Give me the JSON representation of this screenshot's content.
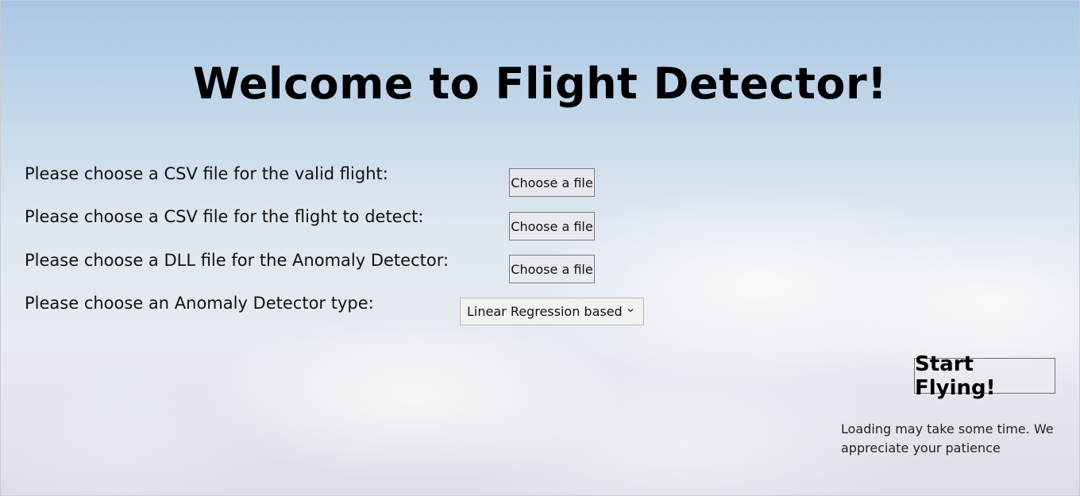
{
  "title": "Welcome to Flight Detector!",
  "form": {
    "valid_flight_label": "Please choose a CSV file for the valid flight:",
    "detect_flight_label": "Please choose a CSV file for the flight to detect:",
    "dll_label": "Please choose a DLL file for the Anomaly Detector:",
    "detector_type_label": "Please choose an Anomaly Detector type:",
    "choose_file_label": "Choose a file",
    "detector_type_selected": "Linear Regression based"
  },
  "start_button_label": "Start Flying!",
  "loading_note": "Loading may take some time. We appreciate your patience",
  "icons": {
    "dropdown": "chevron-down-icon"
  },
  "colors": {
    "sky_top": "#a9c6e3",
    "cloud": "#e7ebf1"
  }
}
